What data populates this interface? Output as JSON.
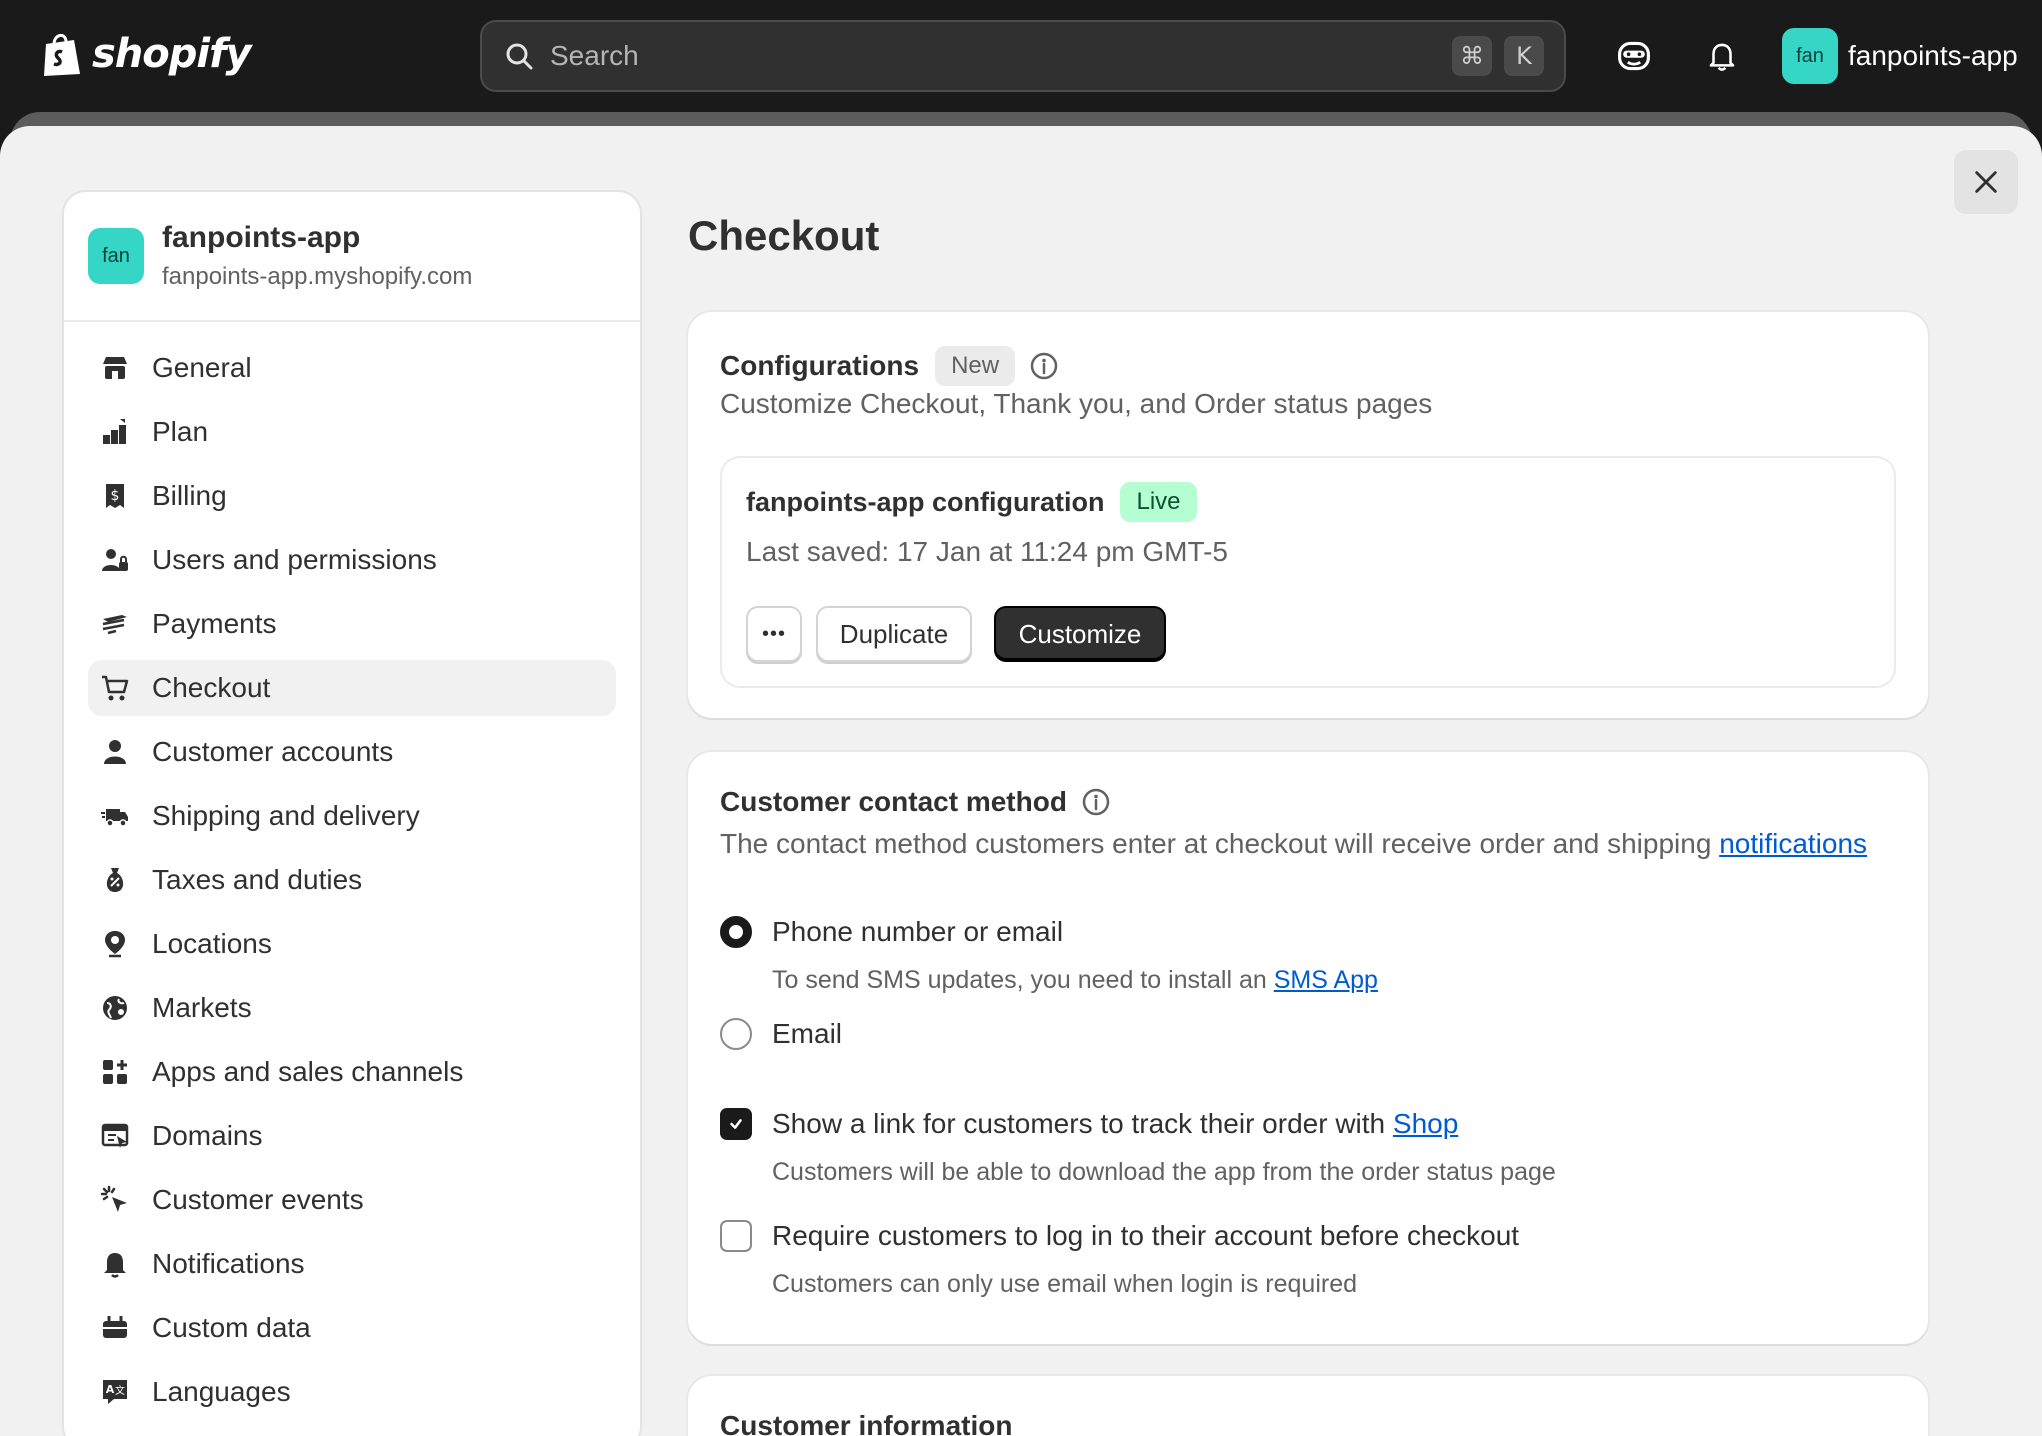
{
  "topbar": {
    "brand": "shopify",
    "search_placeholder": "Search",
    "shortcut_keys": [
      "⌘",
      "K"
    ],
    "store_avatar": "fan",
    "store_name": "fanpoints-app"
  },
  "sidebar": {
    "store": {
      "avatar": "fan",
      "name": "fanpoints-app",
      "domain": "fanpoints-app.myshopify.com"
    },
    "items": [
      {
        "label": "General",
        "icon": "store-icon"
      },
      {
        "label": "Plan",
        "icon": "plan-icon"
      },
      {
        "label": "Billing",
        "icon": "billing-icon"
      },
      {
        "label": "Users and permissions",
        "icon": "users-icon"
      },
      {
        "label": "Payments",
        "icon": "payments-icon"
      },
      {
        "label": "Checkout",
        "icon": "cart-icon",
        "active": true
      },
      {
        "label": "Customer accounts",
        "icon": "person-icon"
      },
      {
        "label": "Shipping and delivery",
        "icon": "truck-icon"
      },
      {
        "label": "Taxes and duties",
        "icon": "taxes-icon"
      },
      {
        "label": "Locations",
        "icon": "location-icon"
      },
      {
        "label": "Markets",
        "icon": "globe-icon"
      },
      {
        "label": "Apps and sales channels",
        "icon": "apps-icon"
      },
      {
        "label": "Domains",
        "icon": "domains-icon"
      },
      {
        "label": "Customer events",
        "icon": "cursor-icon"
      },
      {
        "label": "Notifications",
        "icon": "bell-icon"
      },
      {
        "label": "Custom data",
        "icon": "custom-data-icon"
      },
      {
        "label": "Languages",
        "icon": "languages-icon"
      }
    ]
  },
  "main": {
    "title": "Checkout",
    "configurations": {
      "title": "Configurations",
      "badge": "New",
      "subtitle": "Customize Checkout, Thank you, and Order status pages",
      "config": {
        "name": "fanpoints-app configuration",
        "status": "Live",
        "last_saved": "Last saved: 17 Jan at 11:24 pm GMT-5",
        "more_label": "•••",
        "duplicate_label": "Duplicate",
        "customize_label": "Customize"
      }
    },
    "contact": {
      "title": "Customer contact method",
      "subtitle": "The contact method customers enter at checkout will receive order and shipping",
      "subtitle_link": "notifications",
      "options": [
        {
          "label": "Phone number or email",
          "selected": true,
          "help": "To send SMS updates, you need to install an",
          "help_link": "SMS App"
        },
        {
          "label": "Email",
          "selected": false
        }
      ],
      "track_link": {
        "label": "Show a link for customers to track their order with",
        "link": "Shop",
        "checked": true,
        "help": "Customers will be able to download the app from the order status page"
      },
      "require_login": {
        "label": "Require customers to log in to their account before checkout",
        "checked": false,
        "help": "Customers can only use email when login is required"
      }
    },
    "customer_info": {
      "title": "Customer information"
    }
  },
  "colors": {
    "accent": "#35d6c6",
    "live_badge": "#b4fed2",
    "link": "#005bd3"
  }
}
